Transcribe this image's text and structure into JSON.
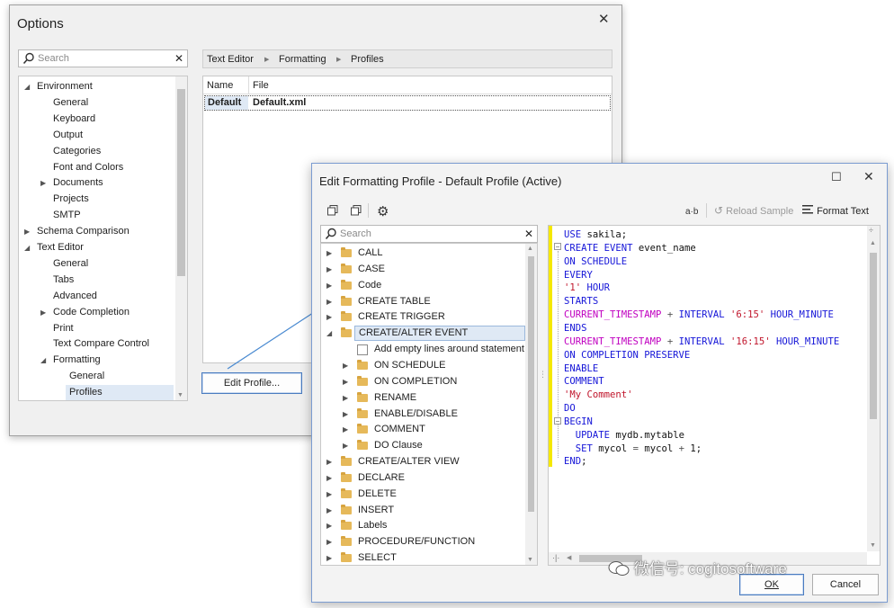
{
  "options_window": {
    "title": "Options",
    "search_placeholder": "Search",
    "breadcrumb": [
      "Text Editor",
      "Formatting",
      "Profiles"
    ],
    "tree": [
      {
        "label": "Environment",
        "arrow": "▲",
        "level": 0
      },
      {
        "label": "General",
        "level": 1
      },
      {
        "label": "Keyboard",
        "level": 1
      },
      {
        "label": "Output",
        "level": 1
      },
      {
        "label": "Categories",
        "level": 1
      },
      {
        "label": "Font and Colors",
        "level": 1
      },
      {
        "label": "Documents",
        "arrow": "▶",
        "level": 1
      },
      {
        "label": "Projects",
        "level": 1
      },
      {
        "label": "SMTP",
        "level": 1
      },
      {
        "label": "Schema Comparison",
        "arrow": "▶",
        "level": 0
      },
      {
        "label": "Text Editor",
        "arrow": "▲",
        "level": 0
      },
      {
        "label": "General",
        "level": 1
      },
      {
        "label": "Tabs",
        "level": 1
      },
      {
        "label": "Advanced",
        "level": 1
      },
      {
        "label": "Code Completion",
        "arrow": "▶",
        "level": 1
      },
      {
        "label": "Print",
        "level": 1
      },
      {
        "label": "Text Compare Control",
        "level": 1
      },
      {
        "label": "Formatting",
        "arrow": "▲",
        "level": 1
      },
      {
        "label": "General",
        "level": 2
      },
      {
        "label": "Profiles",
        "level": 2,
        "selected": true
      }
    ],
    "grid": {
      "columns": [
        "Name",
        "File"
      ],
      "rows": [
        [
          "Default",
          "Default.xml"
        ]
      ]
    },
    "edit_profile_button": "Edit Profile..."
  },
  "dialog": {
    "title": "Edit Formatting Profile - Default Profile (Active)",
    "maximize_glyph": "☐",
    "close_glyph": "✕",
    "toolbar": {
      "ab_label": "a·b",
      "reload_sample": "Reload Sample",
      "format_text": "Format Text"
    },
    "search_placeholder": "Search",
    "tree": [
      {
        "label": "CALL",
        "level": 0,
        "type": "folder"
      },
      {
        "label": "CASE",
        "level": 0,
        "type": "folder"
      },
      {
        "label": "Code",
        "level": 0,
        "type": "folder"
      },
      {
        "label": "CREATE TABLE",
        "level": 0,
        "type": "folder"
      },
      {
        "label": "CREATE TRIGGER",
        "level": 0,
        "type": "folder"
      },
      {
        "label": "CREATE/ALTER EVENT",
        "level": 0,
        "type": "folder",
        "expanded": true,
        "selected": true
      },
      {
        "label": "Add empty lines around statement",
        "level": 1,
        "type": "check"
      },
      {
        "label": "ON SCHEDULE",
        "level": 1,
        "type": "folder"
      },
      {
        "label": "ON COMPLETION",
        "level": 1,
        "type": "folder"
      },
      {
        "label": "RENAME",
        "level": 1,
        "type": "folder"
      },
      {
        "label": "ENABLE/DISABLE",
        "level": 1,
        "type": "folder"
      },
      {
        "label": "COMMENT",
        "level": 1,
        "type": "folder"
      },
      {
        "label": "DO Clause",
        "level": 1,
        "type": "folder"
      },
      {
        "label": "CREATE/ALTER VIEW",
        "level": 0,
        "type": "folder"
      },
      {
        "label": "DECLARE",
        "level": 0,
        "type": "folder"
      },
      {
        "label": "DELETE",
        "level": 0,
        "type": "folder"
      },
      {
        "label": "INSERT",
        "level": 0,
        "type": "folder"
      },
      {
        "label": "Labels",
        "level": 0,
        "type": "folder"
      },
      {
        "label": "PROCEDURE/FUNCTION",
        "level": 0,
        "type": "folder"
      },
      {
        "label": "SELECT",
        "level": 0,
        "type": "folder"
      }
    ],
    "code_lines": [
      [
        [
          "kw",
          "USE"
        ],
        [
          "plain",
          " sakila;"
        ]
      ],
      [
        [
          "kw",
          "CREATE EVENT"
        ],
        [
          "plain",
          " event_name"
        ]
      ],
      [
        [
          "kw",
          "ON SCHEDULE"
        ]
      ],
      [
        [
          "kw",
          "EVERY"
        ]
      ],
      [
        [
          "str",
          "'1'"
        ],
        [
          "plain",
          " "
        ],
        [
          "kw",
          "HOUR"
        ]
      ],
      [
        [
          "kw",
          "STARTS"
        ]
      ],
      [
        [
          "fn",
          "CURRENT_TIMESTAMP"
        ],
        [
          "op",
          " + "
        ],
        [
          "kw",
          "INTERVAL"
        ],
        [
          "plain",
          " "
        ],
        [
          "str",
          "'6:15'"
        ],
        [
          "plain",
          " "
        ],
        [
          "kw",
          "HOUR_MINUTE"
        ]
      ],
      [
        [
          "kw",
          "ENDS"
        ]
      ],
      [
        [
          "fn",
          "CURRENT_TIMESTAMP"
        ],
        [
          "op",
          " + "
        ],
        [
          "kw",
          "INTERVAL"
        ],
        [
          "plain",
          " "
        ],
        [
          "str",
          "'16:15'"
        ],
        [
          "plain",
          " "
        ],
        [
          "kw",
          "HOUR_MINUTE"
        ]
      ],
      [
        [
          "kw",
          "ON COMPLETION PRESERVE"
        ]
      ],
      [
        [
          "kw",
          "ENABLE"
        ]
      ],
      [
        [
          "kw",
          "COMMENT"
        ]
      ],
      [
        [
          "str",
          "'My Comment'"
        ]
      ],
      [
        [
          "kw",
          "DO"
        ]
      ],
      [
        [
          "kw",
          "BEGIN"
        ]
      ],
      [
        [
          "plain",
          "  "
        ],
        [
          "kw",
          "UPDATE"
        ],
        [
          "plain",
          " mydb.mytable"
        ]
      ],
      [
        [
          "plain",
          "  "
        ],
        [
          "kw",
          "SET"
        ],
        [
          "plain",
          " mycol "
        ],
        [
          "op",
          "="
        ],
        [
          "plain",
          " mycol "
        ],
        [
          "op",
          "+"
        ],
        [
          "plain",
          " 1;"
        ]
      ],
      [
        [
          "kw",
          "END"
        ],
        [
          "plain",
          ";"
        ]
      ]
    ],
    "ok_button": "OK",
    "cancel_button": "Cancel"
  },
  "watermark": "微信号: cogitosoftware"
}
